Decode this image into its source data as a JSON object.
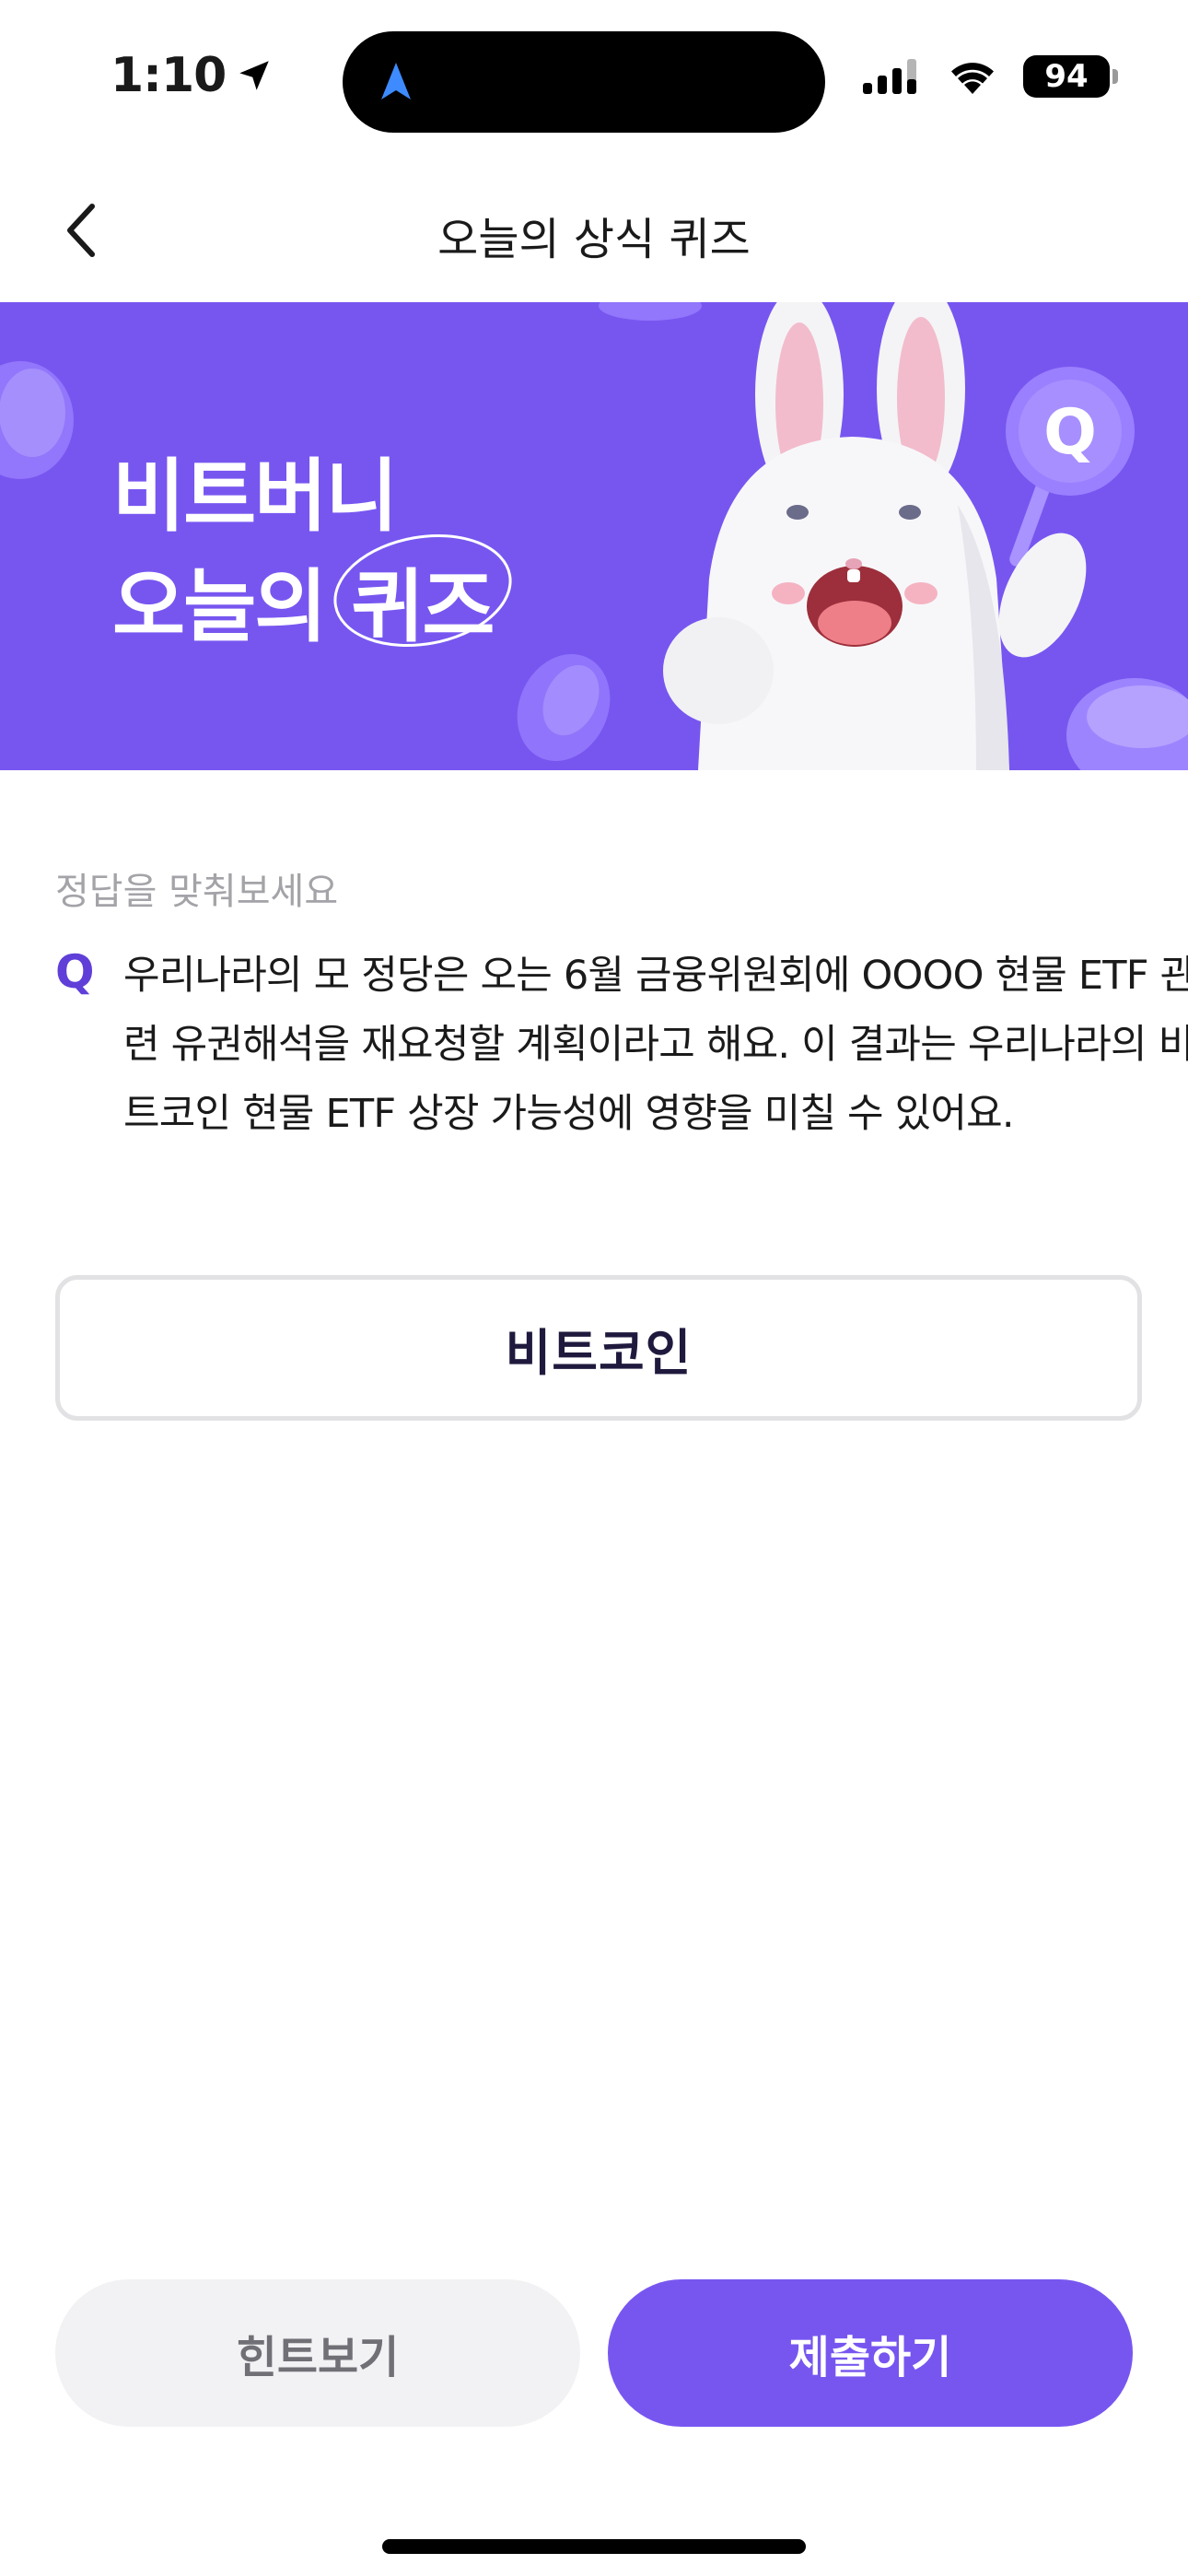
{
  "status_bar": {
    "time": "1:10",
    "battery": "94"
  },
  "nav": {
    "title": "오늘의 상식 퀴즈"
  },
  "banner": {
    "line1": "비트버니",
    "line2_prefix": "오늘의 ",
    "line2_highlight": "퀴즈",
    "badge_letter": "Q",
    "colors": {
      "background": "#7756f0",
      "accent": "#8a6bff"
    }
  },
  "quiz": {
    "label": "정답을 맞춰보세요",
    "q_mark": "Q",
    "question": "우리나라의 모 정당은 오는 6월 금융위원회에 OOOO 현물 ETF 관련 유권해석을 재요청할 계획이라고 해요. 이 결과는 우리나라의 비트코인 현물 ETF 상장 가능성에 영향을 미칠 수 있어요.",
    "answer_value": "비트코인"
  },
  "buttons": {
    "hint": "힌트보기",
    "submit": "제출하기"
  },
  "icons": {
    "back": "chevron-left-icon",
    "location": "location-arrow-icon",
    "signal": "cellular-signal-icon",
    "wifi": "wifi-icon",
    "navigation": "navigation-arrow-icon"
  },
  "colors": {
    "primary": "#7756f0",
    "q_mark": "#5f3fd8",
    "hint_bg": "#f2f2f4",
    "label_gray": "#a3a3a8"
  }
}
